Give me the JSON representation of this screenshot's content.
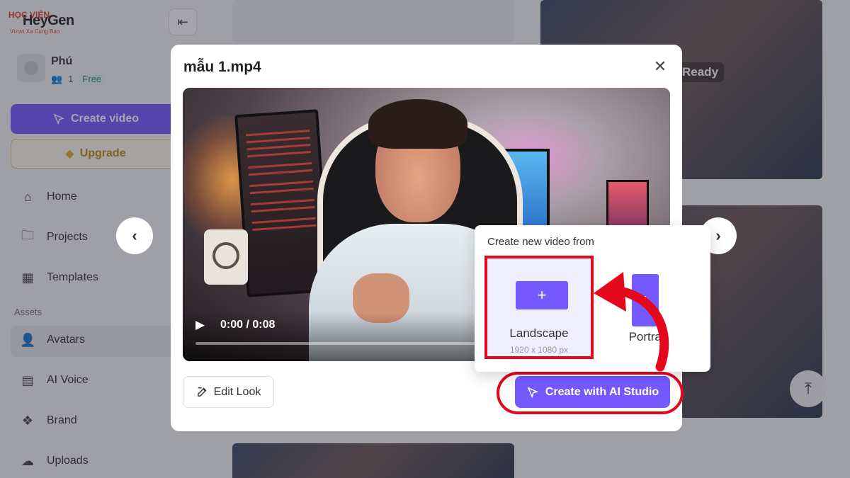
{
  "app": {
    "logo_text": "HeyGen",
    "watermark": "HỌC VIỆN",
    "watermark_sub": "Vươn Xa Cùng Bạn"
  },
  "sidebar": {
    "collapse_icon": "collapse-left-icon",
    "profile": {
      "name": "Phú",
      "members": "1",
      "plan": "Free"
    },
    "create_video_label": "Create video",
    "upgrade_label": "Upgrade",
    "nav": [
      {
        "label": "Home",
        "icon": "home-icon"
      },
      {
        "label": "Projects",
        "icon": "folder-icon"
      },
      {
        "label": "Templates",
        "icon": "film-icon"
      }
    ],
    "assets_heading": "Assets",
    "assets": [
      {
        "label": "Avatars",
        "icon": "avatar-icon",
        "active": true
      },
      {
        "label": "AI Voice",
        "icon": "voice-icon"
      },
      {
        "label": "Brand",
        "icon": "brand-icon"
      },
      {
        "label": "Uploads",
        "icon": "upload-icon"
      }
    ]
  },
  "background": {
    "status_label": "Ready"
  },
  "modal": {
    "title": "mẫu 1.mp4",
    "close_icon": "close-icon",
    "video": {
      "current_time": "0:00",
      "duration": "0:08",
      "time_display": "0:00 / 0:08",
      "progress": 0.0
    },
    "edit_look_label": "Edit Look",
    "create_ai_label": "Create with AI Studio"
  },
  "popover": {
    "title": "Create new video from",
    "options": [
      {
        "label": "Landscape",
        "dimensions": "1920 x 1080 px",
        "icon": "plus-icon"
      },
      {
        "label": "Portrait",
        "icon": "plus-icon"
      }
    ]
  },
  "colors": {
    "accent": "#7559ff",
    "highlight": "#e3081c",
    "upgrade": "#c48a13"
  }
}
